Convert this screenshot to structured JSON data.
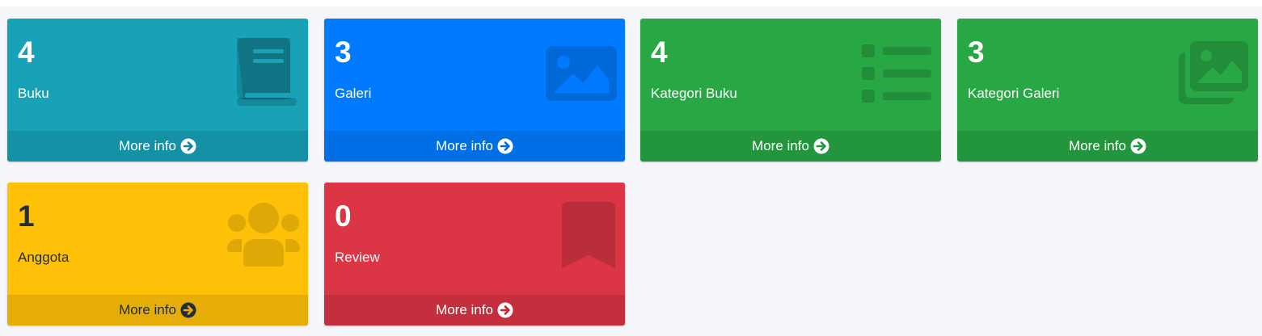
{
  "footer_label": "More info",
  "boxes": [
    {
      "count": "4",
      "label": "Buku",
      "icon": "book-icon",
      "bg": "#17a2b8"
    },
    {
      "count": "3",
      "label": "Galeri",
      "icon": "image-icon",
      "bg": "#007bff"
    },
    {
      "count": "4",
      "label": "Kategori Buku",
      "icon": "list-icon",
      "bg": "#28a745"
    },
    {
      "count": "3",
      "label": "Kategori Galeri",
      "icon": "images-icon",
      "bg": "#28a745"
    },
    {
      "count": "1",
      "label": "Anggota",
      "icon": "users-icon",
      "bg": "#ffc107"
    },
    {
      "count": "0",
      "label": "Review",
      "icon": "bookmark-icon",
      "bg": "#dc3545"
    }
  ]
}
